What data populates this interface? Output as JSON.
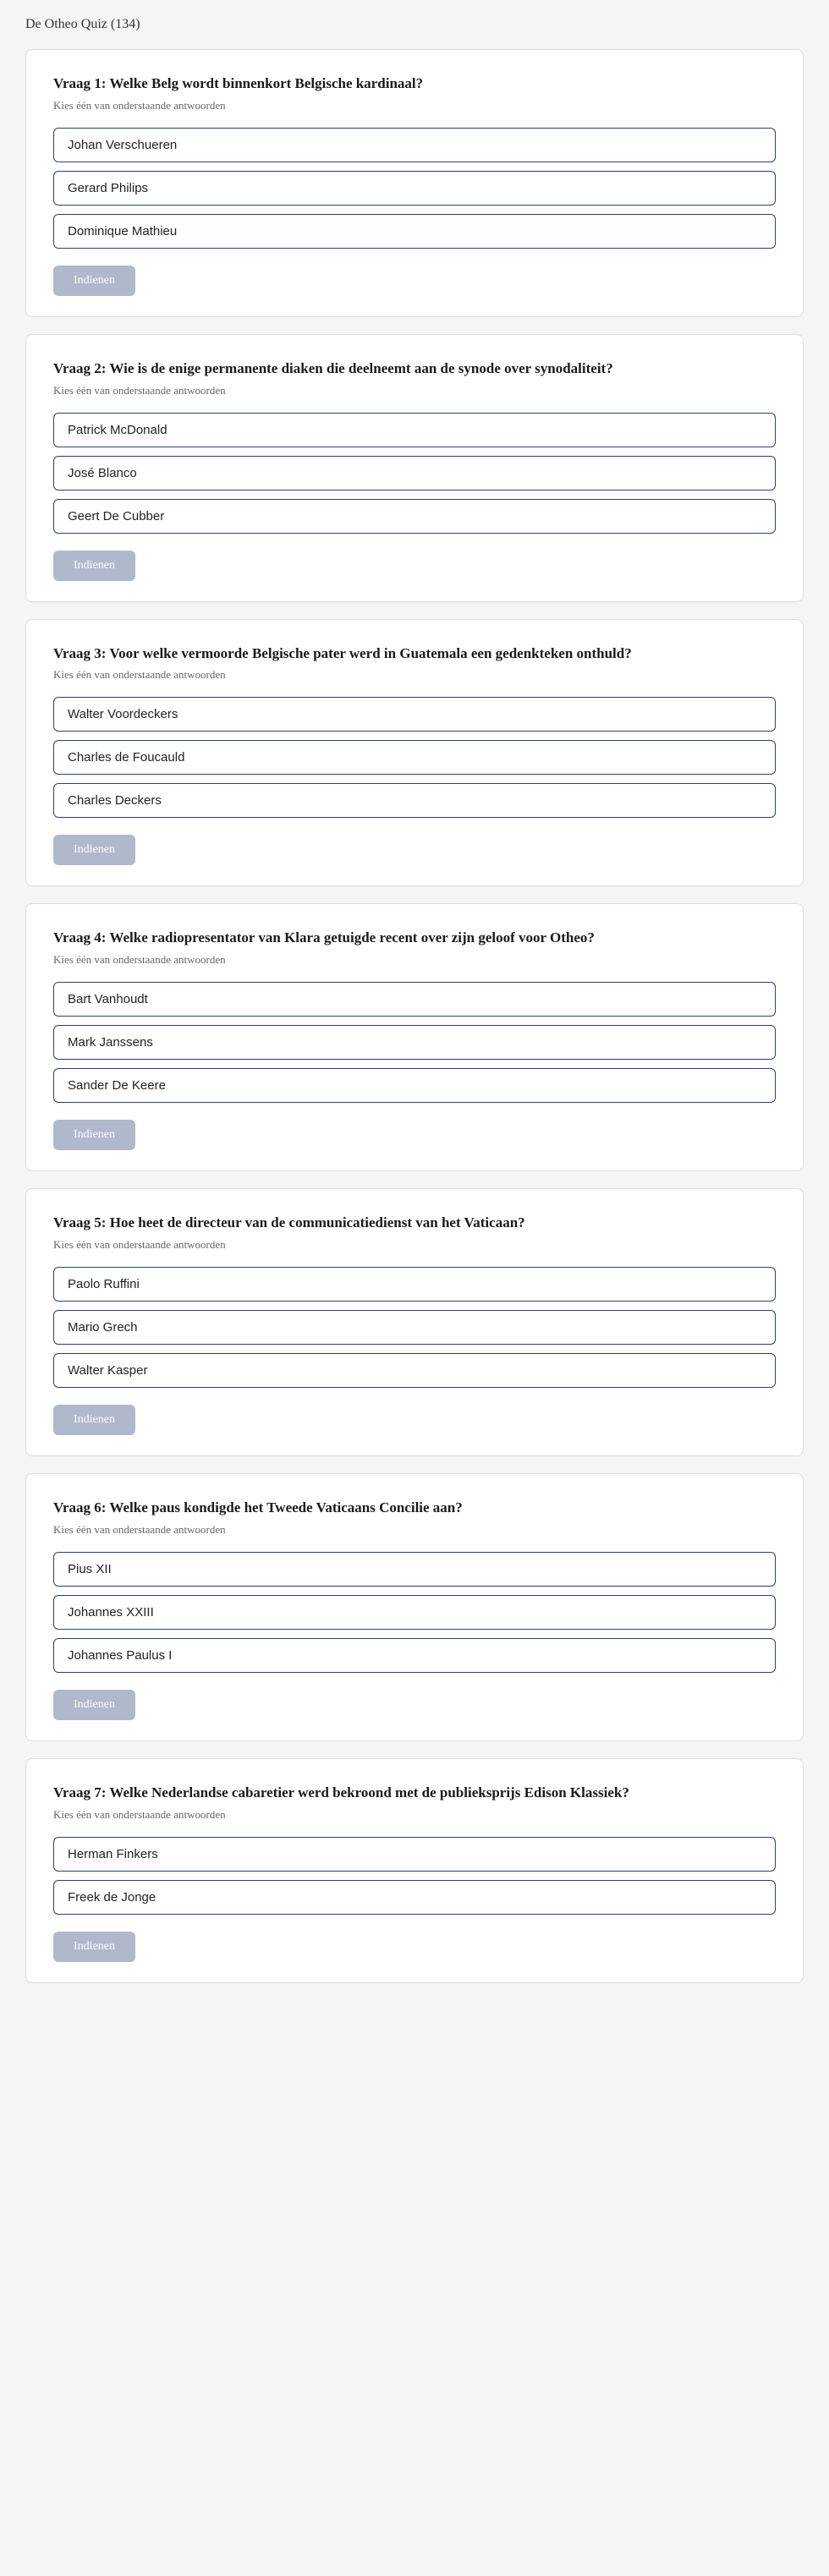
{
  "page": {
    "title": "De Otheo Quiz (134)"
  },
  "questions": [
    {
      "id": 1,
      "title": "Vraag 1: Welke Belg wordt binnenkort Belgische kardinaal?",
      "subtitle": "Kies één van onderstaande antwoorden",
      "answers": [
        "Johan Verschueren",
        "Gerard Philips",
        "Dominique Mathieu"
      ],
      "submit_label": "Indienen"
    },
    {
      "id": 2,
      "title": "Vraag 2: Wie is de enige permanente diaken die deelneemt aan de synode over synodaliteit?",
      "subtitle": "Kies één van onderstaande antwoorden",
      "answers": [
        "Patrick McDonald",
        "José Blanco",
        "Geert De Cubber"
      ],
      "submit_label": "Indienen"
    },
    {
      "id": 3,
      "title": "Vraag 3: Voor welke vermoorde Belgische pater werd in Guatemala een gedenkteken onthuld?",
      "subtitle": "Kies één van onderstaande antwoorden",
      "answers": [
        "Walter Voordeckers",
        "Charles de Foucauld",
        "Charles Deckers"
      ],
      "submit_label": "Indienen"
    },
    {
      "id": 4,
      "title": "Vraag 4: Welke radiopresentator van Klara getuigde recent over zijn geloof voor Otheo?",
      "subtitle": "Kies één van onderstaande antwoorden",
      "answers": [
        "Bart Vanhoudt",
        "Mark Janssens",
        "Sander De Keere"
      ],
      "submit_label": "Indienen"
    },
    {
      "id": 5,
      "title": "Vraag 5: Hoe heet de directeur van de communicatiedienst van het Vaticaan?",
      "subtitle": "Kies één van onderstaande antwoorden",
      "answers": [
        "Paolo Ruffini",
        "Mario Grech",
        "Walter Kasper"
      ],
      "submit_label": "Indienen"
    },
    {
      "id": 6,
      "title": "Vraag 6: Welke paus kondigde het Tweede Vaticaans Concilie aan?",
      "subtitle": "Kies één van onderstaande antwoorden",
      "answers": [
        "Pius XII",
        "Johannes XXIII",
        "Johannes Paulus I"
      ],
      "submit_label": "Indienen"
    },
    {
      "id": 7,
      "title": "Vraag 7: Welke Nederlandse cabaretier werd bekroond met de publieksprijs Edison Klassiek?",
      "subtitle": "Kies één van onderstaande antwoorden",
      "answers": [
        "Herman Finkers",
        "Freek de Jonge"
      ],
      "submit_label": "Indienen"
    }
  ]
}
